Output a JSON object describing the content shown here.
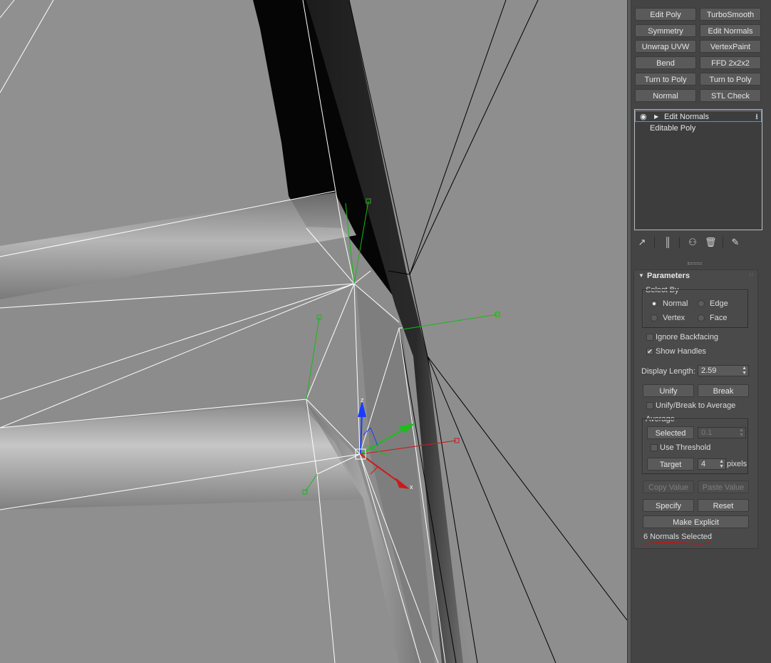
{
  "modifier_buttons": [
    {
      "label": "Edit Poly"
    },
    {
      "label": "TurboSmooth"
    },
    {
      "label": "Symmetry"
    },
    {
      "label": "Edit Normals"
    },
    {
      "label": "Unwrap UVW"
    },
    {
      "label": "VertexPaint"
    },
    {
      "label": "Bend"
    },
    {
      "label": "FFD 2x2x2"
    },
    {
      "label": "Turn to Poly"
    },
    {
      "label": "Turn to Poly"
    },
    {
      "label": "Normal"
    },
    {
      "label": "STL Check"
    }
  ],
  "modifier_stack": {
    "items": [
      {
        "label": "Edit Normals",
        "selected": true
      },
      {
        "label": "Editable Poly",
        "selected": false
      }
    ]
  },
  "stack_toolbar": {
    "icons": [
      "pin-stack-icon",
      "show-end-result-icon",
      "make-unique-icon",
      "remove-modifier-icon",
      "configure-modifier-sets-icon"
    ]
  },
  "rollout": {
    "title": "Parameters",
    "select_by": {
      "label": "Select By",
      "options": [
        {
          "label": "Normal",
          "selected": true
        },
        {
          "label": "Edge",
          "selected": false
        },
        {
          "label": "Vertex",
          "selected": false
        },
        {
          "label": "Face",
          "selected": false
        }
      ]
    },
    "ignore_backfacing": {
      "label": "Ignore Backfacing",
      "checked": false
    },
    "show_handles": {
      "label": "Show Handles",
      "checked": true
    },
    "display_length": {
      "label": "Display Length:",
      "value": "2.59"
    },
    "unify_label": "Unify",
    "break_label": "Break",
    "unify_break_to_average": {
      "label": "Unify/Break to Average",
      "checked": false
    },
    "average": {
      "label": "Average",
      "selected_label": "Selected",
      "selected_value": "0.1",
      "use_threshold": {
        "label": "Use Threshold",
        "checked": false
      },
      "target_label": "Target",
      "target_value": "4",
      "pixels_label": "pixels"
    },
    "copy_value_label": "Copy Value",
    "paste_value_label": "Paste Value",
    "specify_label": "Specify",
    "reset_label": "Reset",
    "make_explicit_label": "Make Explicit",
    "status": "6 Normals Selected"
  },
  "gizmo": {
    "z_label": "z",
    "x_label": "x"
  },
  "colors": {
    "axis_x": "#d01818",
    "axis_y": "#18c018",
    "axis_z": "#1a3cff",
    "status_underline": "#cc1111"
  }
}
